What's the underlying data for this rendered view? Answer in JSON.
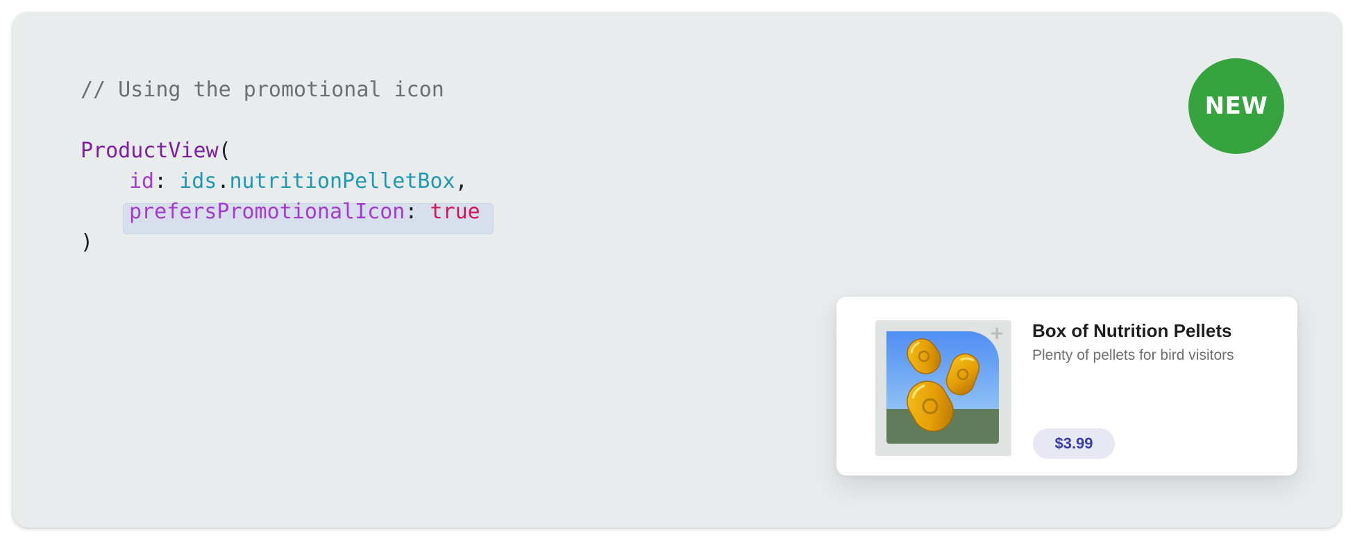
{
  "code": {
    "comment": "// Using the promotional icon",
    "type_name": "ProductView",
    "open_paren": "(",
    "param1_name": "id",
    "colon": ":",
    "ids_prefix": "ids",
    "dot": ".",
    "param1_value": "nutritionPelletBox",
    "comma": ",",
    "param2_name": "prefersPromotionalIcon",
    "param2_value": "true",
    "close_paren": ")"
  },
  "badge": {
    "label": "NEW",
    "color": "#36a33f"
  },
  "product_card": {
    "title": "Box of Nutrition Pellets",
    "subtitle": "Plenty of pellets for bird visitors",
    "price": "$3.99",
    "icon": "plus-icon",
    "artwork": "nutrition-pellets-promotional-icon"
  },
  "colors": {
    "comment": "#6e6e73",
    "type": "#7d1fa5",
    "parameter": "#a43ad0",
    "identifier": "#1f98b2",
    "keyword": "#d4145a",
    "price": "#3a3fa6"
  }
}
